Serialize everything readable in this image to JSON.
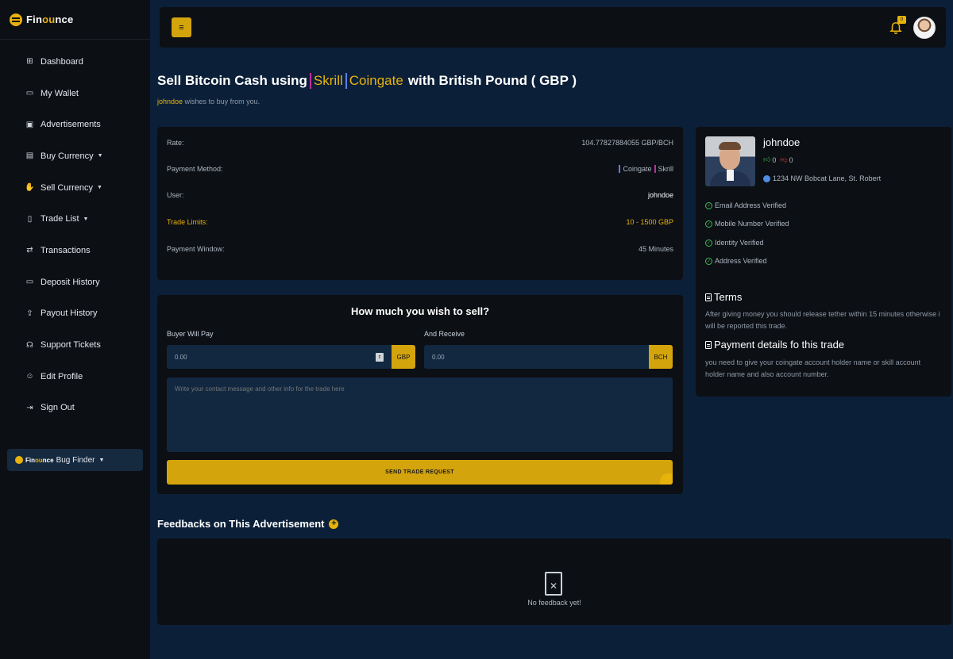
{
  "brand": {
    "name_a": "Fin",
    "name_b": "ou",
    "name_c": "nce"
  },
  "sidebar": {
    "items": [
      {
        "label": "Dashboard",
        "icon": "grid-icon",
        "glyph": "⊞"
      },
      {
        "label": "My Wallet",
        "icon": "wallet-icon",
        "glyph": "▭"
      },
      {
        "label": "Advertisements",
        "icon": "image-icon",
        "glyph": "▣"
      },
      {
        "label": "Buy Currency",
        "icon": "cash-icon",
        "glyph": "▤",
        "caret": true
      },
      {
        "label": "Sell Currency",
        "icon": "hand-coin-icon",
        "glyph": "✋",
        "caret": true
      },
      {
        "label": "Trade List",
        "icon": "document-icon",
        "glyph": "▯",
        "caret": true
      },
      {
        "label": "Transactions",
        "icon": "exchange-icon",
        "glyph": "⇄"
      },
      {
        "label": "Deposit History",
        "icon": "history-icon",
        "glyph": "▭"
      },
      {
        "label": "Payout History",
        "icon": "payout-icon",
        "glyph": "⇪"
      },
      {
        "label": "Support Tickets",
        "icon": "headset-icon",
        "glyph": "☊"
      },
      {
        "label": "Edit Profile",
        "icon": "user-edit-icon",
        "glyph": "☺"
      },
      {
        "label": "Sign Out",
        "icon": "sign-out-icon",
        "glyph": "⇥"
      }
    ],
    "bug_finder": {
      "brand": "Finounce",
      "label": "Bug Finder"
    }
  },
  "topbar": {
    "menu_glyph": "≡",
    "notification_count": "0"
  },
  "heading": {
    "prefix": "Sell Bitcoin Cash using",
    "method1": "Skrill",
    "method2": "Coingate",
    "suffix": "with British Pound ( GBP )",
    "sub_user": "johndoe",
    "sub_text": " wishes to buy from you."
  },
  "info": {
    "rate_label": "Rate:",
    "rate_value": "104.77827884055 GBP/BCH",
    "payment_label": "Payment Method:",
    "payment_1": "Coingate",
    "payment_2": "Skrill",
    "user_label": "User:",
    "user_value": "johndoe",
    "limits_label": "Trade Limits:",
    "limits_value": "10 - 1500 GBP",
    "window_label": "Payment Window:",
    "window_value": "45 Minutes"
  },
  "form": {
    "title": "How much you wish to sell?",
    "pay_label": "Buyer Will Pay",
    "pay_value": "0.00",
    "pay_currency": "GBP",
    "receive_label": "And Receive",
    "receive_value": "0.00",
    "receive_currency": "BCH",
    "message_placeholder": "Write your contact message and other info for the trade here",
    "submit_label": "SEND TRADE REQUEST"
  },
  "profile": {
    "name": "johndoe",
    "upvotes": "0",
    "downvotes": "0",
    "address": "1234 NW Bobcat Lane, St. Robert",
    "verifications": [
      "Email Address Verified",
      "Mobile Number Verified",
      "Identity Verified",
      "Address Verified"
    ],
    "terms_title": "Terms",
    "terms_text": "After giving money you should release tether within 15 minutes otherwise i will be reported this trade.",
    "payment_title": "Payment details fo this trade",
    "payment_text": "you need to give your coingate account holder name or skill account holder name and also account number."
  },
  "feedback": {
    "title": "Feedbacks on This Advertisement",
    "empty_text": "No feedback yet!"
  },
  "colors": {
    "accent": "#d4a40c",
    "bg": "#0b2038",
    "panel": "#0c0f14",
    "skrill": "#c02e9b",
    "coingate": "#5e7df0"
  }
}
